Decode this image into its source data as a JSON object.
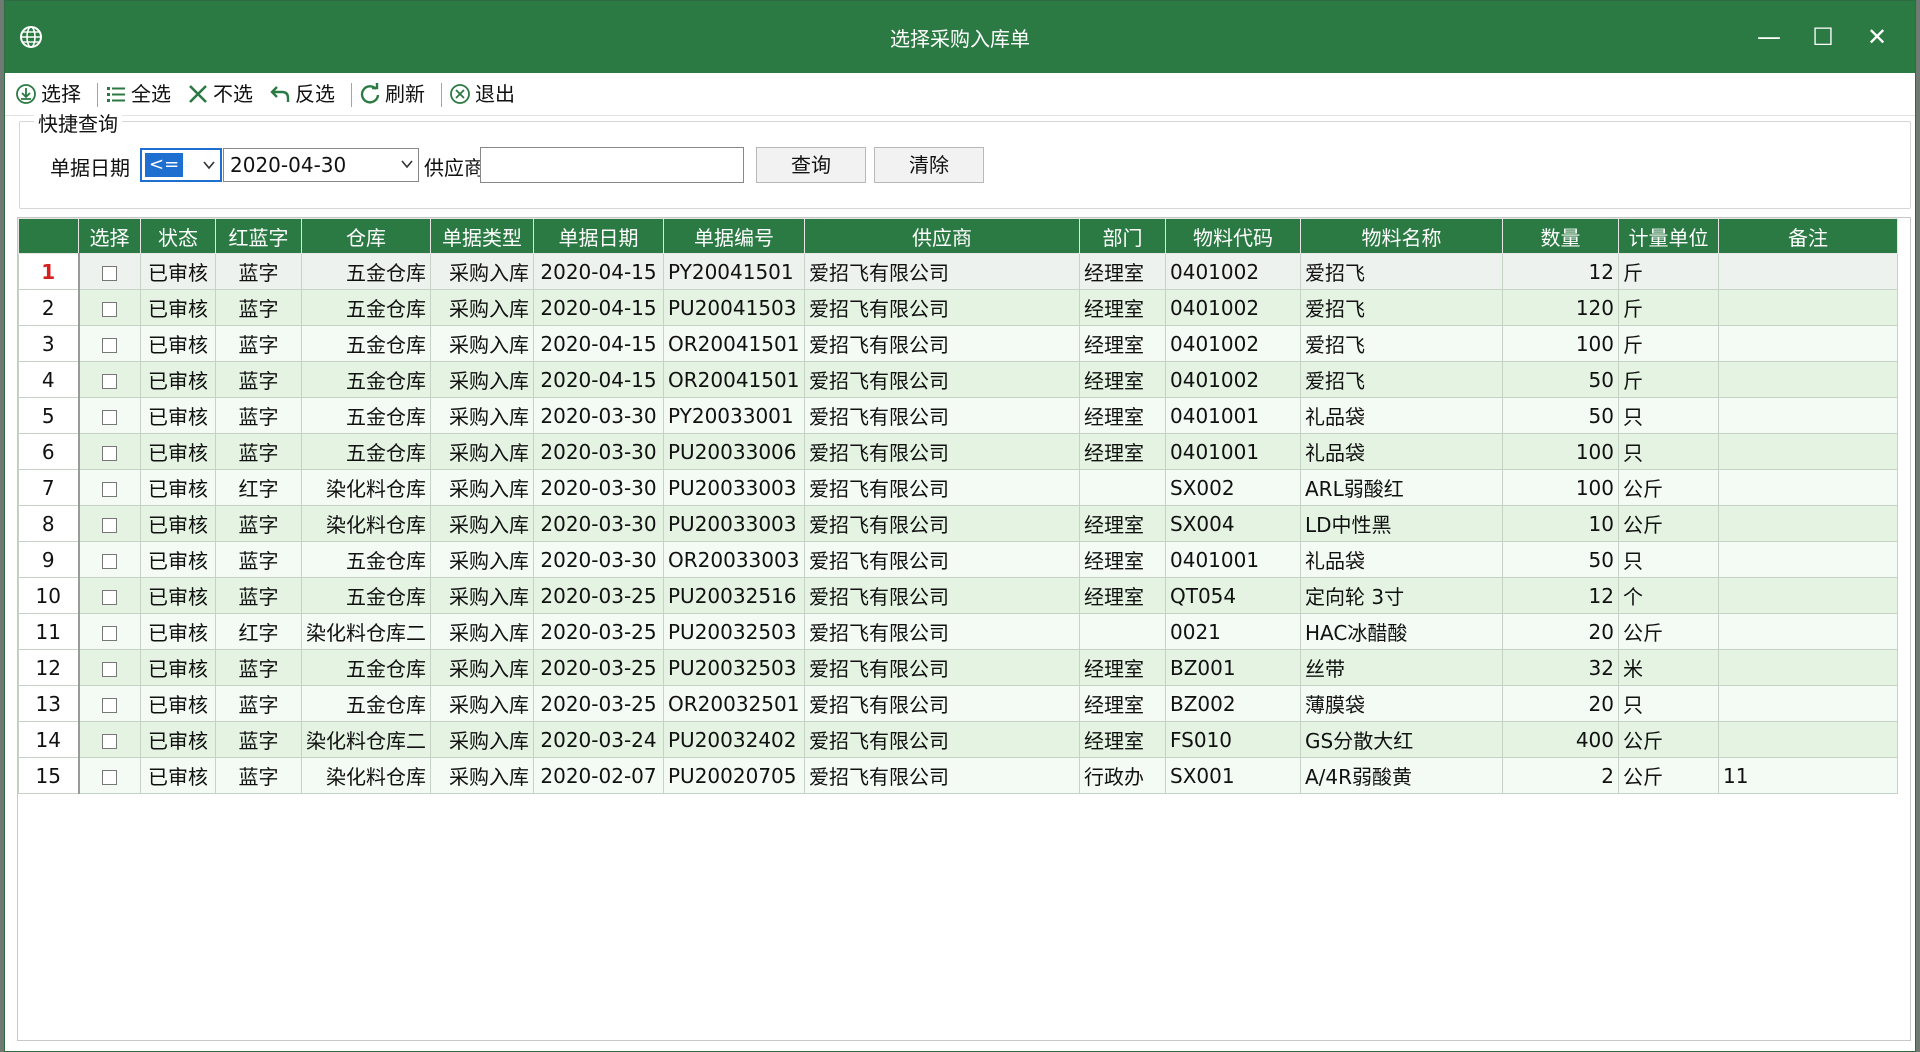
{
  "window": {
    "title": "选择采购入库单",
    "minimize": "—",
    "maximize": "☐",
    "close": "✕"
  },
  "toolbar": {
    "select": "选择",
    "select_all": "全选",
    "select_none": "不选",
    "invert": "反选",
    "refresh": "刷新",
    "exit": "退出"
  },
  "query": {
    "group_title": "快捷查询",
    "date_label": "单据日期",
    "operator": "<=",
    "date_value": "2020-04-30",
    "supplier_label": "供应商",
    "supplier_value": "",
    "search_button": "查询",
    "clear_button": "清除"
  },
  "grid": {
    "columns": [
      "选择",
      "状态",
      "红蓝字",
      "仓库",
      "单据类型",
      "单据日期",
      "单据编号",
      "供应商",
      "部门",
      "物料代码",
      "物料名称",
      "数量",
      "计量单位",
      "备注"
    ],
    "rows": [
      {
        "no": "1",
        "status": "已审核",
        "color": "蓝字",
        "warehouse": "五金仓库",
        "type": "采购入库",
        "date": "2020-04-15",
        "code": "PY20041501",
        "supplier": "爱招飞有限公司",
        "dept": "经理室",
        "item_code": "0401002",
        "item_name": "爱招飞",
        "qty": "12",
        "unit": "斤",
        "remark": ""
      },
      {
        "no": "2",
        "status": "已审核",
        "color": "蓝字",
        "warehouse": "五金仓库",
        "type": "采购入库",
        "date": "2020-04-15",
        "code": "PU20041503",
        "supplier": "爱招飞有限公司",
        "dept": "经理室",
        "item_code": "0401002",
        "item_name": "爱招飞",
        "qty": "120",
        "unit": "斤",
        "remark": ""
      },
      {
        "no": "3",
        "status": "已审核",
        "color": "蓝字",
        "warehouse": "五金仓库",
        "type": "采购入库",
        "date": "2020-04-15",
        "code": "OR20041501",
        "supplier": "爱招飞有限公司",
        "dept": "经理室",
        "item_code": "0401002",
        "item_name": "爱招飞",
        "qty": "100",
        "unit": "斤",
        "remark": ""
      },
      {
        "no": "4",
        "status": "已审核",
        "color": "蓝字",
        "warehouse": "五金仓库",
        "type": "采购入库",
        "date": "2020-04-15",
        "code": "OR20041501",
        "supplier": "爱招飞有限公司",
        "dept": "经理室",
        "item_code": "0401002",
        "item_name": "爱招飞",
        "qty": "50",
        "unit": "斤",
        "remark": ""
      },
      {
        "no": "5",
        "status": "已审核",
        "color": "蓝字",
        "warehouse": "五金仓库",
        "type": "采购入库",
        "date": "2020-03-30",
        "code": "PY20033001",
        "supplier": "爱招飞有限公司",
        "dept": "经理室",
        "item_code": "0401001",
        "item_name": "礼品袋",
        "qty": "50",
        "unit": "只",
        "remark": ""
      },
      {
        "no": "6",
        "status": "已审核",
        "color": "蓝字",
        "warehouse": "五金仓库",
        "type": "采购入库",
        "date": "2020-03-30",
        "code": "PU20033006",
        "supplier": "爱招飞有限公司",
        "dept": "经理室",
        "item_code": "0401001",
        "item_name": "礼品袋",
        "qty": "100",
        "unit": "只",
        "remark": ""
      },
      {
        "no": "7",
        "status": "已审核",
        "color": "红字",
        "warehouse": "染化料仓库",
        "type": "采购入库",
        "date": "2020-03-30",
        "code": "PU20033003",
        "supplier": "爱招飞有限公司",
        "dept": "",
        "item_code": "SX002",
        "item_name": "ARL弱酸红",
        "qty": "100",
        "unit": "公斤",
        "remark": ""
      },
      {
        "no": "8",
        "status": "已审核",
        "color": "蓝字",
        "warehouse": "染化料仓库",
        "type": "采购入库",
        "date": "2020-03-30",
        "code": "PU20033003",
        "supplier": "爱招飞有限公司",
        "dept": "经理室",
        "item_code": "SX004",
        "item_name": "LD中性黑",
        "qty": "10",
        "unit": "公斤",
        "remark": ""
      },
      {
        "no": "9",
        "status": "已审核",
        "color": "蓝字",
        "warehouse": "五金仓库",
        "type": "采购入库",
        "date": "2020-03-30",
        "code": "OR20033003",
        "supplier": "爱招飞有限公司",
        "dept": "经理室",
        "item_code": "0401001",
        "item_name": "礼品袋",
        "qty": "50",
        "unit": "只",
        "remark": ""
      },
      {
        "no": "10",
        "status": "已审核",
        "color": "蓝字",
        "warehouse": "五金仓库",
        "type": "采购入库",
        "date": "2020-03-25",
        "code": "PU20032516",
        "supplier": "爱招飞有限公司",
        "dept": "经理室",
        "item_code": "QT054",
        "item_name": "定向轮 3寸",
        "qty": "12",
        "unit": "个",
        "remark": ""
      },
      {
        "no": "11",
        "status": "已审核",
        "color": "红字",
        "warehouse": "染化料仓库二",
        "type": "采购入库",
        "date": "2020-03-25",
        "code": "PU20032503",
        "supplier": "爱招飞有限公司",
        "dept": "",
        "item_code": "0021",
        "item_name": "HAC冰醋酸",
        "qty": "20",
        "unit": "公斤",
        "remark": ""
      },
      {
        "no": "12",
        "status": "已审核",
        "color": "蓝字",
        "warehouse": "五金仓库",
        "type": "采购入库",
        "date": "2020-03-25",
        "code": "PU20032503",
        "supplier": "爱招飞有限公司",
        "dept": "经理室",
        "item_code": "BZ001",
        "item_name": "丝带",
        "qty": "32",
        "unit": "米",
        "remark": ""
      },
      {
        "no": "13",
        "status": "已审核",
        "color": "蓝字",
        "warehouse": "五金仓库",
        "type": "采购入库",
        "date": "2020-03-25",
        "code": "OR20032501",
        "supplier": "爱招飞有限公司",
        "dept": "经理室",
        "item_code": "BZ002",
        "item_name": "薄膜袋",
        "qty": "20",
        "unit": "只",
        "remark": ""
      },
      {
        "no": "14",
        "status": "已审核",
        "color": "蓝字",
        "warehouse": "染化料仓库二",
        "type": "采购入库",
        "date": "2020-03-24",
        "code": "PU20032402",
        "supplier": "爱招飞有限公司",
        "dept": "经理室",
        "item_code": "FS010",
        "item_name": "GS分散大红",
        "qty": "400",
        "unit": "公斤",
        "remark": ""
      },
      {
        "no": "15",
        "status": "已审核",
        "color": "蓝字",
        "warehouse": "染化料仓库",
        "type": "采购入库",
        "date": "2020-02-07",
        "code": "PU20020705",
        "supplier": "爱招飞有限公司",
        "dept": "行政办",
        "item_code": "SX001",
        "item_name": "A/4R弱酸黄",
        "qty": "2",
        "unit": "公斤",
        "remark": "11"
      }
    ]
  },
  "colors": {
    "title_bar": "#2b7a43",
    "header": "#2b7a43",
    "row_odd": "#f4faf4",
    "row_even": "#e4f3e2",
    "current_row_marker": "#d61f1f"
  }
}
